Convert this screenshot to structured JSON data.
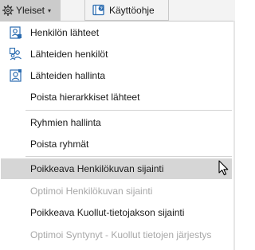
{
  "toolbar": {
    "general_label": "Yleiset",
    "general_icon": "gear-icon",
    "guide_label": "Käyttöohje",
    "guide_icon": "help-book-icon"
  },
  "menu": {
    "items": [
      {
        "label": "Henkilön lähteet",
        "icon": "person-sources-icon",
        "enabled": true
      },
      {
        "label": "Lähteiden henkilöt",
        "icon": "source-persons-icon",
        "enabled": true
      },
      {
        "label": "Lähteiden hallinta",
        "icon": "manage-sources-icon",
        "enabled": true
      },
      {
        "label": "Poista hierarkkiset lähteet",
        "enabled": true
      },
      {
        "label": "Ryhmien hallinta",
        "enabled": true
      },
      {
        "label": "Poista ryhmät",
        "enabled": true
      },
      {
        "label": "Poikkeava Henkilökuvan sijainti",
        "enabled": true,
        "hovered": true
      },
      {
        "label": "Optimoi Henkilökuvan sijainti",
        "enabled": false
      },
      {
        "label": "Poikkeava Kuollut-tietojakson sijainti",
        "enabled": true
      },
      {
        "label": "Optimoi Syntynyt - Kuollut tietojen järjestys",
        "enabled": false
      }
    ]
  },
  "colors": {
    "accent_blue": "#2b6cb0",
    "hover_bg": "#d6d6d6",
    "disabled_text": "#a8a8a8"
  }
}
